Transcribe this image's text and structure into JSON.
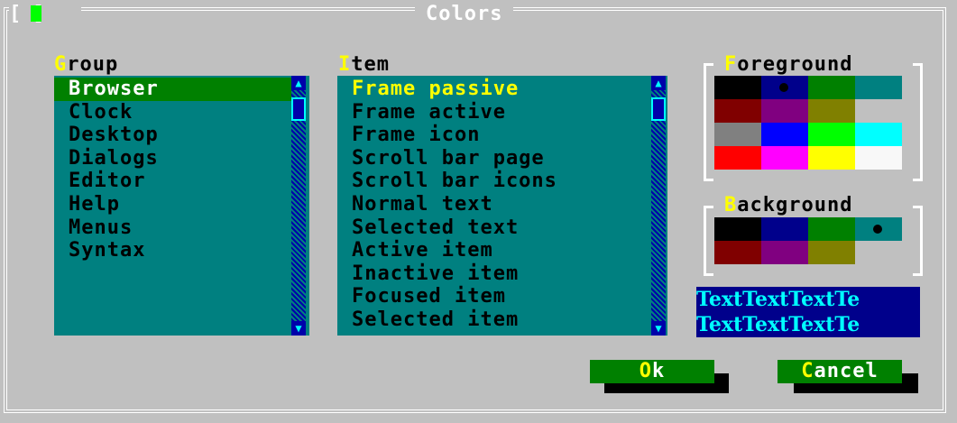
{
  "window": {
    "title": "Colors",
    "close_button": "[ ]"
  },
  "group": {
    "label_hot": "G",
    "label_rest": "roup",
    "items": [
      "Browser",
      "Clock",
      "Desktop",
      "Dialogs",
      "Editor",
      "Help",
      "Menus",
      "Syntax"
    ],
    "selected": "Browser"
  },
  "item": {
    "label_hot": "I",
    "label_rest": "tem",
    "items": [
      "Frame passive",
      "Frame active",
      "Frame icon",
      "Scroll bar page",
      "Scroll bar icons",
      "Normal text",
      "Selected text",
      "Active item",
      "Inactive item",
      "Focused item",
      "Selected item"
    ],
    "focused": "Frame passive"
  },
  "foreground": {
    "label_hot": "F",
    "label_rest": "oreground",
    "colors": [
      "#000000",
      "#00008b",
      "#008000",
      "#008080",
      "#800000",
      "#800080",
      "#808000",
      "#c0c0c0",
      "#808080",
      "#0000ff",
      "#00ff00",
      "#00ffff",
      "#ff0000",
      "#ff00ff",
      "#ffff00",
      "#f8f8f8"
    ],
    "selected_index": 1
  },
  "background": {
    "label_hot": "B",
    "label_rest": "ackground",
    "colors": [
      "#000000",
      "#00008b",
      "#008000",
      "#008080",
      "#800000",
      "#800080",
      "#808000"
    ],
    "selected_index": 3
  },
  "sample": {
    "line1": "TextTextTextTe",
    "line2": "TextTextTextTe"
  },
  "buttons": {
    "ok_hot": "O",
    "ok_rest": "k",
    "cancel_hot": "C",
    "cancel_rest": "ancel"
  },
  "colors": {
    "dialog": "#c0c0c0",
    "list_bg": "#008080",
    "selected_bg": "#008000",
    "hotkey": "#ffff00"
  }
}
